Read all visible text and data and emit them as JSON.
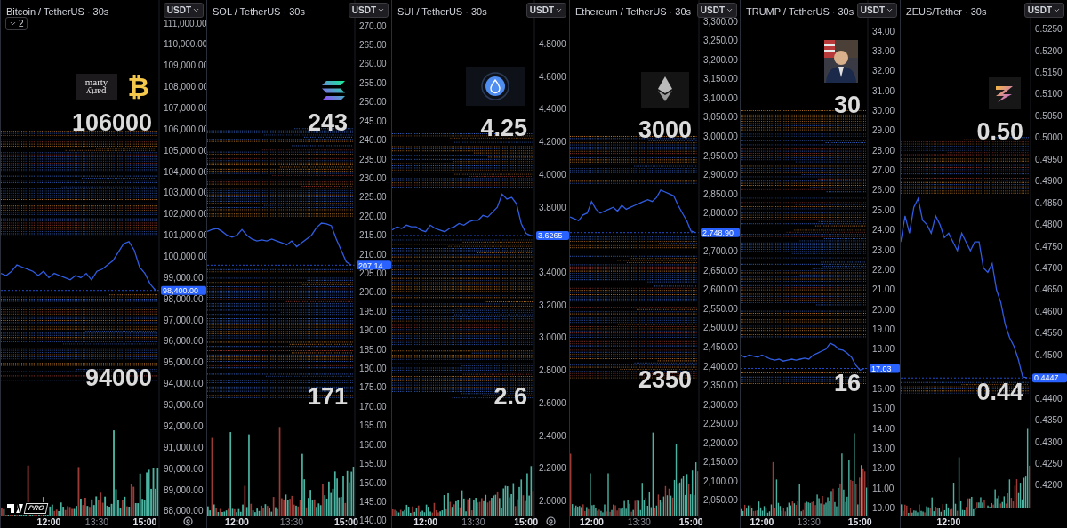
{
  "panels": [
    {
      "title": "Bitcoin / TetherUS · 30s",
      "currency": "USDT",
      "collapse_count": "2",
      "badge": "PRO",
      "settings": true,
      "footer_box": false,
      "logos": [
        {
          "kind": "wordmark",
          "lines": [
            "marty",
            "party"
          ]
        },
        {
          "kind": "glyph",
          "text": "₿"
        }
      ],
      "chart_data": {
        "type": "line",
        "ylim": [
          87200,
          112090
        ],
        "yticks": [
          {
            "value": 111000,
            "label": "111,000.00"
          },
          {
            "value": 110000,
            "label": "110,000.00"
          },
          {
            "value": 109000,
            "label": "109,000.00"
          },
          {
            "value": 108000,
            "label": "108,000.00"
          },
          {
            "value": 107000,
            "label": "107,000.00"
          },
          {
            "value": 106000,
            "label": "106,000.00"
          },
          {
            "value": 105000,
            "label": "105,000.00"
          },
          {
            "value": 104000,
            "label": "104,000.00"
          },
          {
            "value": 103000,
            "label": "103,000.00"
          },
          {
            "value": 102000,
            "label": "102,000.00"
          },
          {
            "value": 101000,
            "label": "101,000.00"
          },
          {
            "value": 100000,
            "label": "100,000.00"
          },
          {
            "value": 99000,
            "label": "99,000.00"
          },
          {
            "value": 98000,
            "label": "98,000.00"
          },
          {
            "value": 97000,
            "label": "97,000.00"
          },
          {
            "value": 96000,
            "label": "96,000.00"
          },
          {
            "value": 95000,
            "label": "95,000.00"
          },
          {
            "value": 94000,
            "label": "94,000.00"
          },
          {
            "value": 93000,
            "label": "93,000.00"
          },
          {
            "value": 92000,
            "label": "92,000.00"
          },
          {
            "value": 91000,
            "label": "91,000.00"
          },
          {
            "value": 90000,
            "label": "90,000.00"
          },
          {
            "value": 89000,
            "label": "89,000.00"
          },
          {
            "value": 88000,
            "label": "88,000.00"
          }
        ],
        "series": [
          {
            "color": "#2f5ce0",
            "values": [
              99200,
              99100,
              99300,
              99600,
              99500,
              99400,
              99300,
              99100,
              99300,
              99000,
              99200,
              99100,
              99000,
              98900,
              99100,
              99000,
              99200,
              98900,
              99300,
              99400,
              99600,
              99800,
              100200,
              100600,
              100700,
              100300,
              99500,
              99200,
              98700,
              98400
            ]
          }
        ],
        "categories": [
          null,
          null,
          null,
          null,
          null,
          null,
          null,
          null,
          null,
          "12:00",
          null,
          null,
          null,
          null,
          null,
          null,
          null,
          null,
          "13:30",
          null,
          null,
          null,
          null,
          null,
          null,
          null,
          null,
          "15:00",
          null,
          null
        ]
      },
      "price_tag": "98,400.00",
      "levels": [
        "106000",
        "94000"
      ]
    },
    {
      "title": "SOL / TetherUS · 30s",
      "currency": "USDT",
      "settings": false,
      "footer_box": false,
      "logos": [
        {
          "kind": "sol"
        }
      ],
      "chart_data": {
        "type": "line",
        "ylim": [
          138.1,
          276.8
        ],
        "yticks": [
          {
            "value": 270,
            "label": "270.00"
          },
          {
            "value": 265,
            "label": "265.00"
          },
          {
            "value": 260,
            "label": "260.00"
          },
          {
            "value": 255,
            "label": "255.00"
          },
          {
            "value": 250,
            "label": "250.00"
          },
          {
            "value": 245,
            "label": "245.00"
          },
          {
            "value": 240,
            "label": "240.00"
          },
          {
            "value": 235,
            "label": "235.00"
          },
          {
            "value": 230,
            "label": "230.00"
          },
          {
            "value": 225,
            "label": "225.00"
          },
          {
            "value": 220,
            "label": "220.00"
          },
          {
            "value": 215,
            "label": "215.00"
          },
          {
            "value": 210,
            "label": "210.00"
          },
          {
            "value": 205,
            "label": "205.00"
          },
          {
            "value": 200,
            "label": "200.00"
          },
          {
            "value": 195,
            "label": "195.00"
          },
          {
            "value": 190,
            "label": "190.00"
          },
          {
            "value": 185,
            "label": "185.00"
          },
          {
            "value": 180,
            "label": "180.00"
          },
          {
            "value": 175,
            "label": "175.00"
          },
          {
            "value": 170,
            "label": "170.00"
          },
          {
            "value": 165,
            "label": "165.00"
          },
          {
            "value": 160,
            "label": "160.00"
          },
          {
            "value": 155,
            "label": "155.00"
          },
          {
            "value": 150,
            "label": "150.00"
          },
          {
            "value": 145,
            "label": "145.00"
          },
          {
            "value": 140,
            "label": "140.00"
          }
        ],
        "series": [
          {
            "color": "#2f5ce0",
            "values": [
              216,
              216.5,
              216.8,
              216,
              215,
              214.5,
              215,
              216.5,
              215,
              214,
              213.5,
              213.8,
              213.5,
              214,
              213.5,
              213,
              212.5,
              213.5,
              212,
              213,
              214,
              215,
              217,
              218.2,
              218,
              217.5,
              214,
              211,
              208,
              207.14
            ]
          }
        ],
        "categories": [
          null,
          null,
          null,
          null,
          null,
          null,
          "12:00",
          null,
          null,
          null,
          null,
          null,
          null,
          null,
          null,
          null,
          null,
          "13:30",
          null,
          null,
          null,
          null,
          null,
          null,
          null,
          null,
          null,
          null,
          "15:00",
          null
        ]
      },
      "price_tag": "207.14",
      "levels": [
        "243",
        "171"
      ]
    },
    {
      "title": "SUI / TetherUS · 30s",
      "currency": "USDT",
      "settings": true,
      "footer_box": false,
      "logos": [
        {
          "kind": "sui"
        }
      ],
      "chart_data": {
        "type": "line",
        "ylim": [
          1.834,
          5.07
        ],
        "yticks": [
          {
            "value": 4.8,
            "label": "4.8000"
          },
          {
            "value": 4.6,
            "label": "4.6000"
          },
          {
            "value": 4.4,
            "label": "4.4000"
          },
          {
            "value": 4.2,
            "label": "4.2000"
          },
          {
            "value": 4.0,
            "label": "4.0000"
          },
          {
            "value": 3.8,
            "label": "3.8000"
          },
          {
            "value": 3.4,
            "label": "3.4000"
          },
          {
            "value": 3.2,
            "label": "3.2000"
          },
          {
            "value": 3.0,
            "label": "3.0000"
          },
          {
            "value": 2.8,
            "label": "2.8000"
          },
          {
            "value": 2.6,
            "label": "2.6000"
          },
          {
            "value": 2.4,
            "label": "2.4000"
          },
          {
            "value": 2.2,
            "label": "2.2000"
          },
          {
            "value": 2.0,
            "label": "2.0000"
          }
        ],
        "series": [
          {
            "color": "#2f5ce0",
            "values": [
              3.66,
              3.68,
              3.67,
              3.69,
              3.68,
              3.68,
              3.66,
              3.65,
              3.69,
              3.67,
              3.66,
              3.65,
              3.67,
              3.68,
              3.7,
              3.69,
              3.71,
              3.72,
              3.72,
              3.75,
              3.74,
              3.77,
              3.8,
              3.88,
              3.85,
              3.86,
              3.82,
              3.7,
              3.64,
              3.6265
            ]
          }
        ],
        "categories": [
          null,
          null,
          null,
          null,
          null,
          null,
          null,
          "12:00",
          null,
          null,
          null,
          null,
          null,
          null,
          null,
          null,
          null,
          "13:30",
          null,
          null,
          null,
          null,
          null,
          null,
          null,
          null,
          null,
          null,
          "15:00",
          null
        ]
      },
      "price_tag": "3.6265",
      "levels": [
        "4.25",
        "2.6"
      ]
    },
    {
      "title": "Ethereum / TetherUS · 30s",
      "currency": "USDT",
      "settings": false,
      "footer_box": false,
      "logos": [
        {
          "kind": "eth"
        }
      ],
      "chart_data": {
        "type": "line",
        "ylim": [
          1978,
          3356
        ],
        "yticks": [
          {
            "value": 3300,
            "label": "3,300.00"
          },
          {
            "value": 3250,
            "label": "3,250.00"
          },
          {
            "value": 3200,
            "label": "3,200.00"
          },
          {
            "value": 3150,
            "label": "3,150.00"
          },
          {
            "value": 3100,
            "label": "3,100.00"
          },
          {
            "value": 3050,
            "label": "3,050.00"
          },
          {
            "value": 3000,
            "label": "3,000.00"
          },
          {
            "value": 2950,
            "label": "2,950.00"
          },
          {
            "value": 2900,
            "label": "2,900.00"
          },
          {
            "value": 2850,
            "label": "2,850.00"
          },
          {
            "value": 2800,
            "label": "2,800.00"
          },
          {
            "value": 2700,
            "label": "2,700.00"
          },
          {
            "value": 2650,
            "label": "2,650.00"
          },
          {
            "value": 2600,
            "label": "2,600.00"
          },
          {
            "value": 2550,
            "label": "2,550.00"
          },
          {
            "value": 2500,
            "label": "2,500.00"
          },
          {
            "value": 2450,
            "label": "2,450.00"
          },
          {
            "value": 2400,
            "label": "2,400.00"
          },
          {
            "value": 2350,
            "label": "2,350.00"
          },
          {
            "value": 2300,
            "label": "2,300.00"
          },
          {
            "value": 2250,
            "label": "2,250.00"
          },
          {
            "value": 2200,
            "label": "2,200.00"
          },
          {
            "value": 2150,
            "label": "2,150.00"
          },
          {
            "value": 2100,
            "label": "2,100.00"
          },
          {
            "value": 2050,
            "label": "2,050.00"
          }
        ],
        "series": [
          {
            "color": "#2f5ce0",
            "values": [
              2790,
              2785,
              2780,
              2795,
              2800,
              2830,
              2810,
              2800,
              2805,
              2810,
              2815,
              2805,
              2820,
              2810,
              2815,
              2820,
              2825,
              2830,
              2835,
              2830,
              2840,
              2860,
              2855,
              2850,
              2845,
              2820,
              2800,
              2780,
              2753,
              2748.9
            ]
          }
        ],
        "categories": [
          null,
          null,
          null,
          null,
          null,
          "12:00",
          null,
          null,
          null,
          null,
          null,
          null,
          null,
          null,
          null,
          null,
          "13:30",
          null,
          null,
          null,
          null,
          null,
          null,
          null,
          null,
          null,
          null,
          null,
          "15:00",
          null
        ]
      },
      "price_tag": "2,748.90",
      "levels": [
        "3000",
        "2350"
      ]
    },
    {
      "title": "TRUMP / TetherUS · 30s",
      "currency": "USDT",
      "settings": false,
      "footer_box": false,
      "chart_data": {
        "type": "line",
        "ylim": [
          9.0,
          35.57
        ],
        "yticks": [
          {
            "value": 34,
            "label": "34.00"
          },
          {
            "value": 33,
            "label": "33.00"
          },
          {
            "value": 32,
            "label": "32.00"
          },
          {
            "value": 31,
            "label": "31.00"
          },
          {
            "value": 30,
            "label": "30.00"
          },
          {
            "value": 29,
            "label": "29.00"
          },
          {
            "value": 28,
            "label": "28.00"
          },
          {
            "value": 27,
            "label": "27.00"
          },
          {
            "value": 26,
            "label": "26.00"
          },
          {
            "value": 25,
            "label": "25.00"
          },
          {
            "value": 24,
            "label": "24.00"
          },
          {
            "value": 23,
            "label": "23.00"
          },
          {
            "value": 22,
            "label": "22.00"
          },
          {
            "value": 21,
            "label": "21.00"
          },
          {
            "value": 20,
            "label": "20.00"
          },
          {
            "value": 19,
            "label": "19.00"
          },
          {
            "value": 18,
            "label": "18.00"
          },
          {
            "value": 16,
            "label": "16.00"
          },
          {
            "value": 15,
            "label": "15.00"
          },
          {
            "value": 14,
            "label": "14.00"
          },
          {
            "value": 13,
            "label": "13.00"
          },
          {
            "value": 12,
            "label": "12.00"
          },
          {
            "value": 11,
            "label": "11.00"
          },
          {
            "value": 10,
            "label": "10.00"
          }
        ],
        "series": [
          {
            "color": "#2f5ce0",
            "values": [
              17.7,
              17.6,
              17.7,
              17.65,
              17.6,
              17.7,
              17.6,
              17.5,
              17.45,
              17.5,
              17.4,
              17.45,
              17.5,
              17.45,
              17.5,
              17.55,
              17.5,
              17.7,
              17.8,
              17.9,
              18.0,
              18.3,
              18.2,
              18.0,
              17.95,
              17.8,
              17.6,
              17.2,
              16.95,
              17.03
            ]
          }
        ],
        "categories": [
          null,
          null,
          null,
          null,
          null,
          "12:00",
          null,
          null,
          null,
          null,
          null,
          null,
          null,
          null,
          null,
          null,
          "13:30",
          null,
          null,
          null,
          null,
          null,
          null,
          null,
          null,
          null,
          null,
          null,
          "15:00",
          null
        ]
      },
      "price_tag": "17.03",
      "levels": [
        "30",
        "16"
      ]
    },
    {
      "title": "ZEUS/Tether · 30s",
      "currency": "USDT",
      "settings": false,
      "footer_box": true,
      "logos": [
        {
          "kind": "zeus"
        }
      ],
      "chart_data": {
        "type": "line",
        "ylim": [
          0.41018,
          0.53167
        ],
        "yticks": [
          {
            "value": 0.525,
            "label": "0.5250"
          },
          {
            "value": 0.52,
            "label": "0.5200"
          },
          {
            "value": 0.515,
            "label": "0.5150"
          },
          {
            "value": 0.51,
            "label": "0.5100"
          },
          {
            "value": 0.505,
            "label": "0.5050"
          },
          {
            "value": 0.5,
            "label": "0.5000"
          },
          {
            "value": 0.495,
            "label": "0.4950"
          },
          {
            "value": 0.49,
            "label": "0.4900"
          },
          {
            "value": 0.485,
            "label": "0.4850"
          },
          {
            "value": 0.48,
            "label": "0.4800"
          },
          {
            "value": 0.475,
            "label": "0.4750"
          },
          {
            "value": 0.47,
            "label": "0.4700"
          },
          {
            "value": 0.465,
            "label": "0.4650"
          },
          {
            "value": 0.46,
            "label": "0.4600"
          },
          {
            "value": 0.455,
            "label": "0.4550"
          },
          {
            "value": 0.45,
            "label": "0.4500"
          },
          {
            "value": 0.44,
            "label": "0.4400"
          },
          {
            "value": 0.435,
            "label": "0.4350"
          },
          {
            "value": 0.43,
            "label": "0.4300"
          },
          {
            "value": 0.425,
            "label": "0.4250"
          },
          {
            "value": 0.42,
            "label": "0.4200"
          }
        ],
        "series": [
          {
            "color": "#2f5ce0",
            "values": [
              0.476,
              0.482,
              0.478,
              0.484,
              0.486,
              0.481,
              0.48,
              0.478,
              0.482,
              0.48,
              0.477,
              0.478,
              0.476,
              0.474,
              0.478,
              0.476,
              0.474,
              0.476,
              0.476,
              0.47,
              0.469,
              0.471,
              0.465,
              0.462,
              0.457,
              0.454,
              0.452,
              0.449,
              0.445,
              0.4447
            ]
          }
        ],
        "categories": [
          null,
          null,
          null,
          null,
          null,
          null,
          null,
          null,
          null,
          null,
          null,
          "12:00",
          null,
          null,
          null,
          null,
          null,
          null,
          null,
          null,
          null,
          null,
          null,
          null,
          null,
          null,
          null,
          null,
          null,
          null
        ]
      },
      "price_tag": "0.4447",
      "levels": [
        "0.50",
        "0.44"
      ]
    }
  ]
}
